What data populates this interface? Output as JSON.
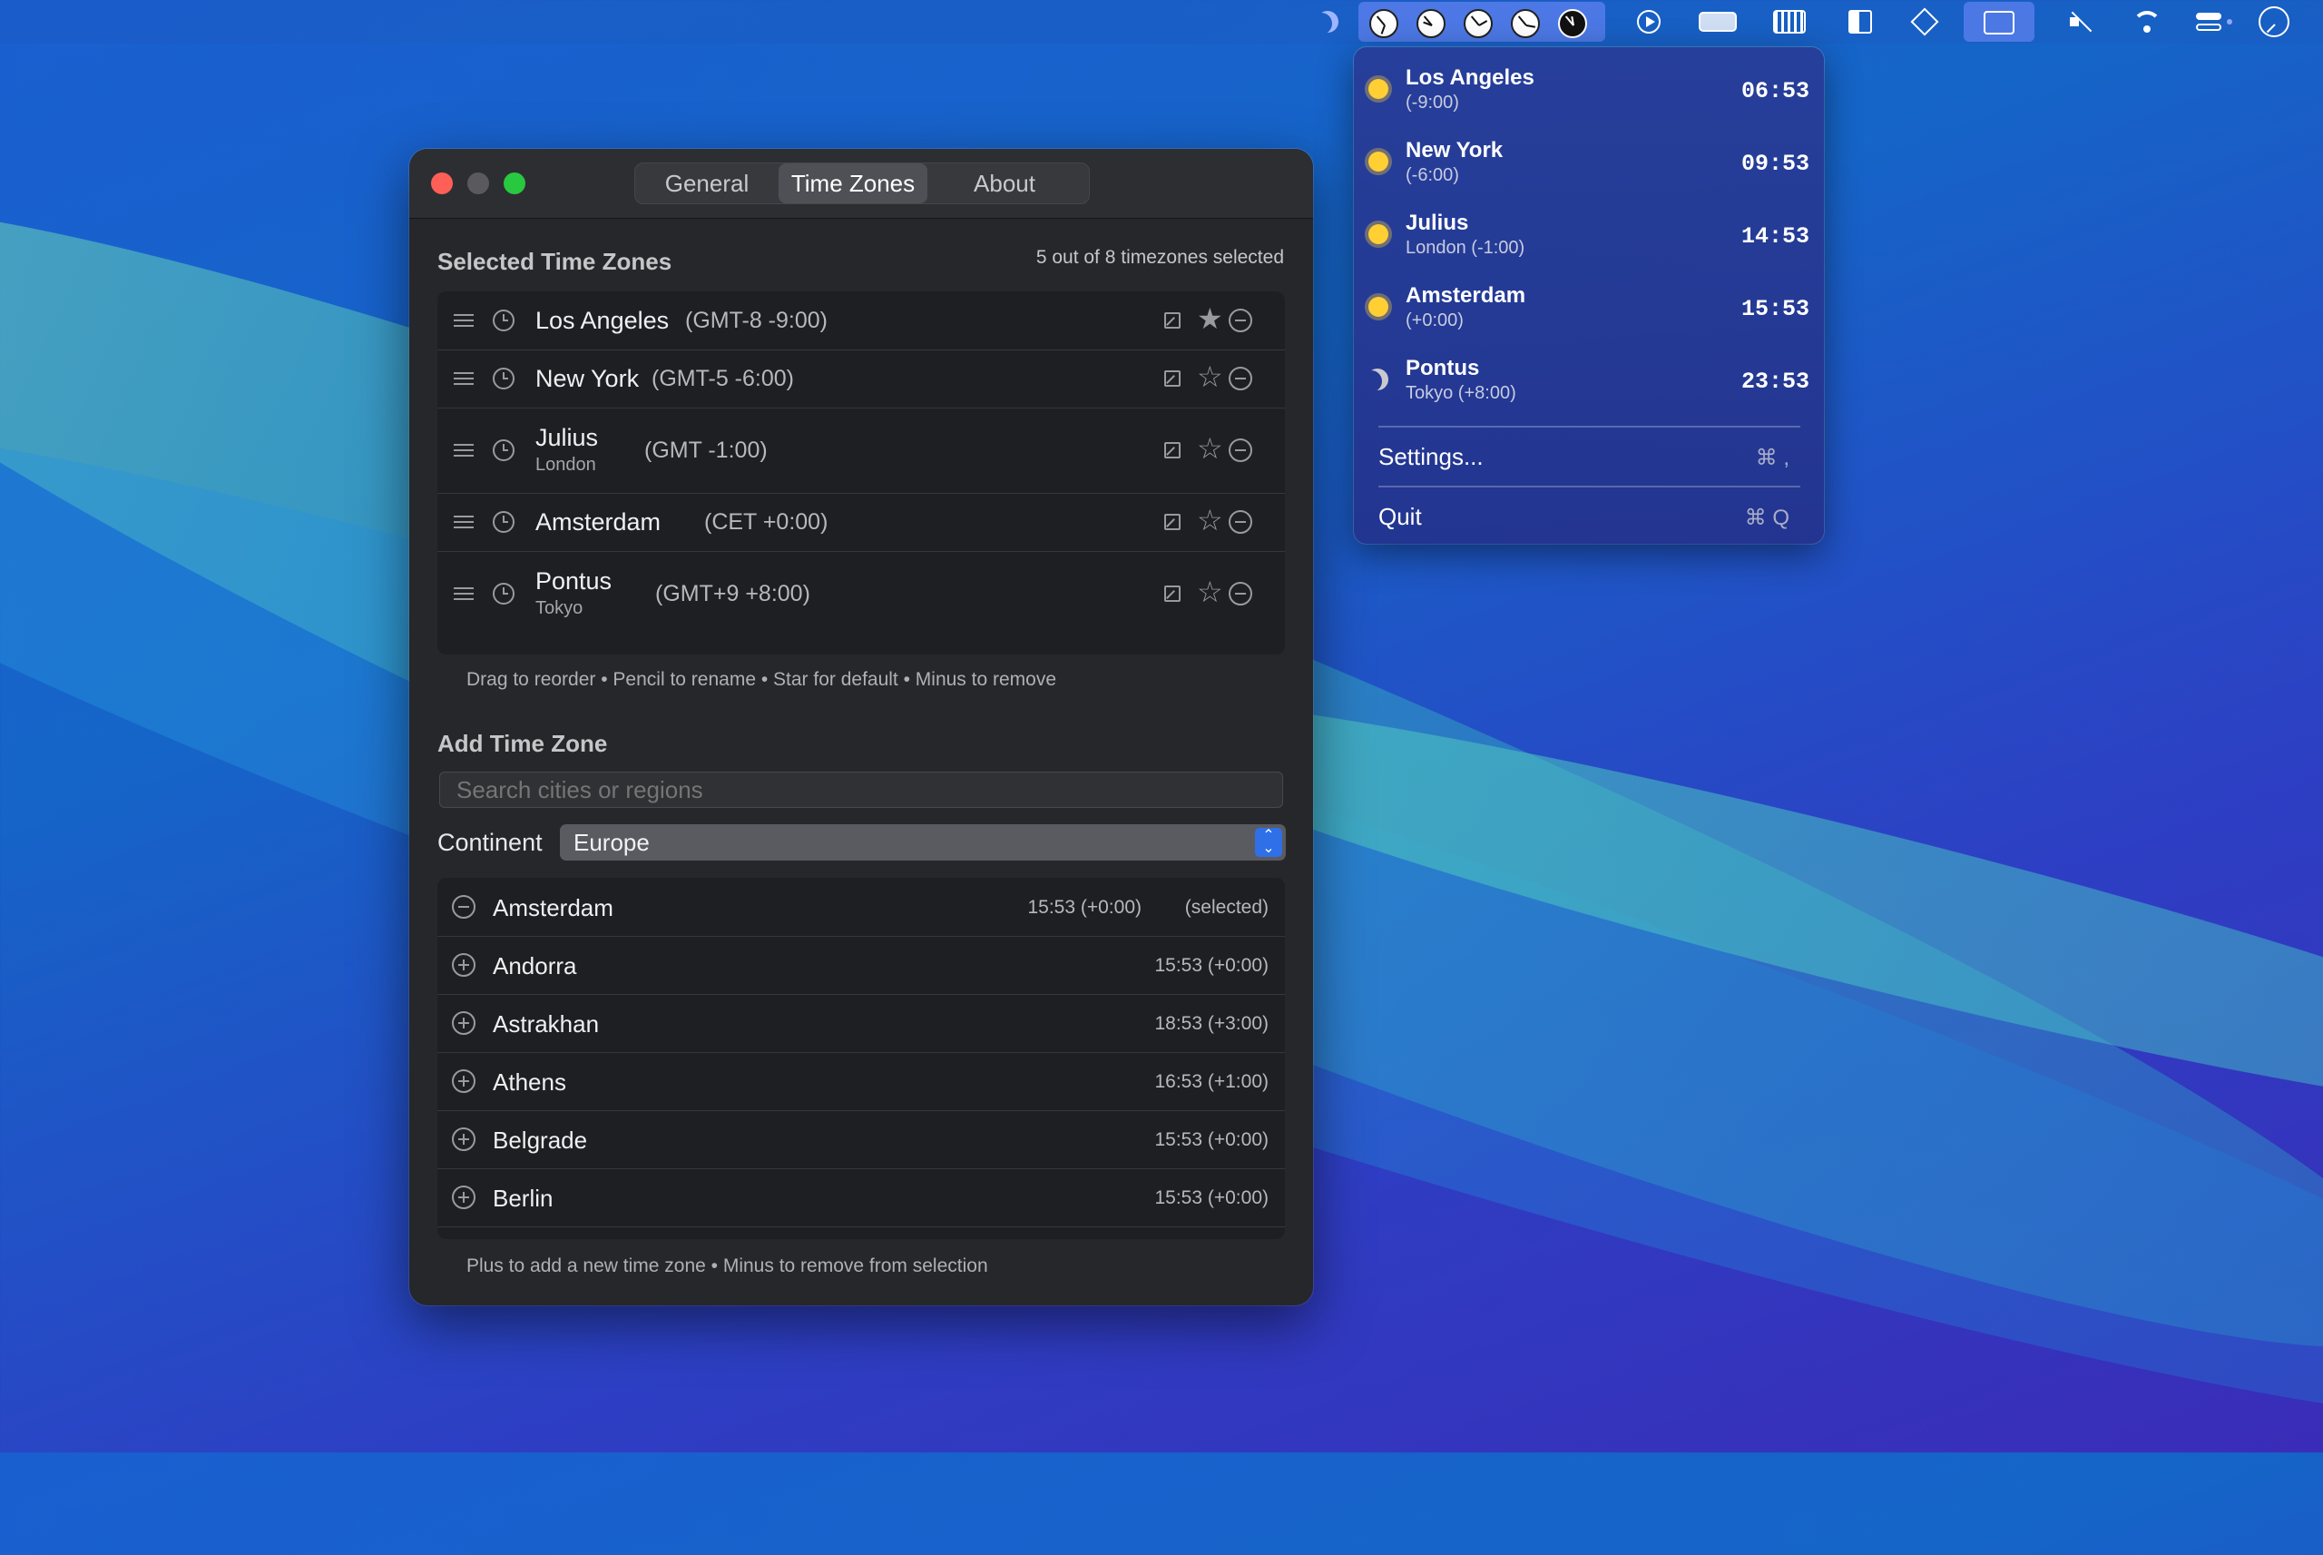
{
  "menubar": {
    "icons": [
      "moon-icon",
      "clock-icon",
      "clock-icon",
      "clock-icon",
      "clock-icon",
      "clock-icon",
      "play-icon",
      "battery-charging-icon",
      "keyboard-icon",
      "layout-icon",
      "layers-icon",
      "window-icon",
      "mute-icon",
      "wifi-icon",
      "control-center-icon",
      "clock-outline-icon"
    ]
  },
  "window": {
    "tabs": [
      "General",
      "Time Zones",
      "About"
    ],
    "active_tab": "Time Zones",
    "selected_section": {
      "title": "Selected Time Zones",
      "count": "5 out of 8 timezones selected",
      "rows": [
        {
          "city": "Los Angeles",
          "sub": "",
          "tz": "(GMT-8 -9:00)",
          "default": true
        },
        {
          "city": "New York",
          "sub": "",
          "tz": "(GMT-5 -6:00)",
          "default": false
        },
        {
          "city": "Julius",
          "sub": "London",
          "tz": "(GMT -1:00)",
          "default": false
        },
        {
          "city": "Amsterdam",
          "sub": "",
          "tz": "(CET +0:00)",
          "default": false
        },
        {
          "city": "Pontus",
          "sub": "Tokyo",
          "tz": "(GMT+9 +8:00)",
          "default": false
        }
      ],
      "hint": "Drag to reorder • Pencil to rename • Star for default • Minus to remove"
    },
    "add_section": {
      "title": "Add Time Zone",
      "search_placeholder": "Search cities or regions",
      "continent_label": "Continent",
      "continent_value": "Europe",
      "cities": [
        {
          "name": "Amsterdam",
          "time": "15:53 (+0:00)",
          "status": "(selected)",
          "selected": true
        },
        {
          "name": "Andorra",
          "time": "15:53 (+0:00)",
          "status": "",
          "selected": false
        },
        {
          "name": "Astrakhan",
          "time": "18:53 (+3:00)",
          "status": "",
          "selected": false
        },
        {
          "name": "Athens",
          "time": "16:53 (+1:00)",
          "status": "",
          "selected": false
        },
        {
          "name": "Belgrade",
          "time": "15:53 (+0:00)",
          "status": "",
          "selected": false
        },
        {
          "name": "Berlin",
          "time": "15:53 (+0:00)",
          "status": "",
          "selected": false
        }
      ],
      "hint": "Plus to add a new time zone • Minus to remove from selection"
    }
  },
  "menu": {
    "zones": [
      {
        "city": "Los Angeles",
        "sub": "(-9:00)",
        "time": "06:53",
        "icon": "sun-icon"
      },
      {
        "city": "New York",
        "sub": "(-6:00)",
        "time": "09:53",
        "icon": "sun-icon"
      },
      {
        "city": "Julius",
        "sub": "London (-1:00)",
        "time": "14:53",
        "icon": "sun-icon"
      },
      {
        "city": "Amsterdam",
        "sub": "(+0:00)",
        "time": "15:53",
        "icon": "sun-icon"
      },
      {
        "city": "Pontus",
        "sub": "Tokyo (+8:00)",
        "time": "23:53",
        "icon": "moon-icon"
      }
    ],
    "settings_label": "Settings...",
    "settings_key": "⌘ ,",
    "quit_label": "Quit",
    "quit_key": "⌘ Q"
  },
  "colors": {
    "accent": "#2f6fe8",
    "close": "#ff5f57",
    "minimize": "#5a5a5e",
    "zoom": "#28c840",
    "sun": "#ffcf33"
  }
}
